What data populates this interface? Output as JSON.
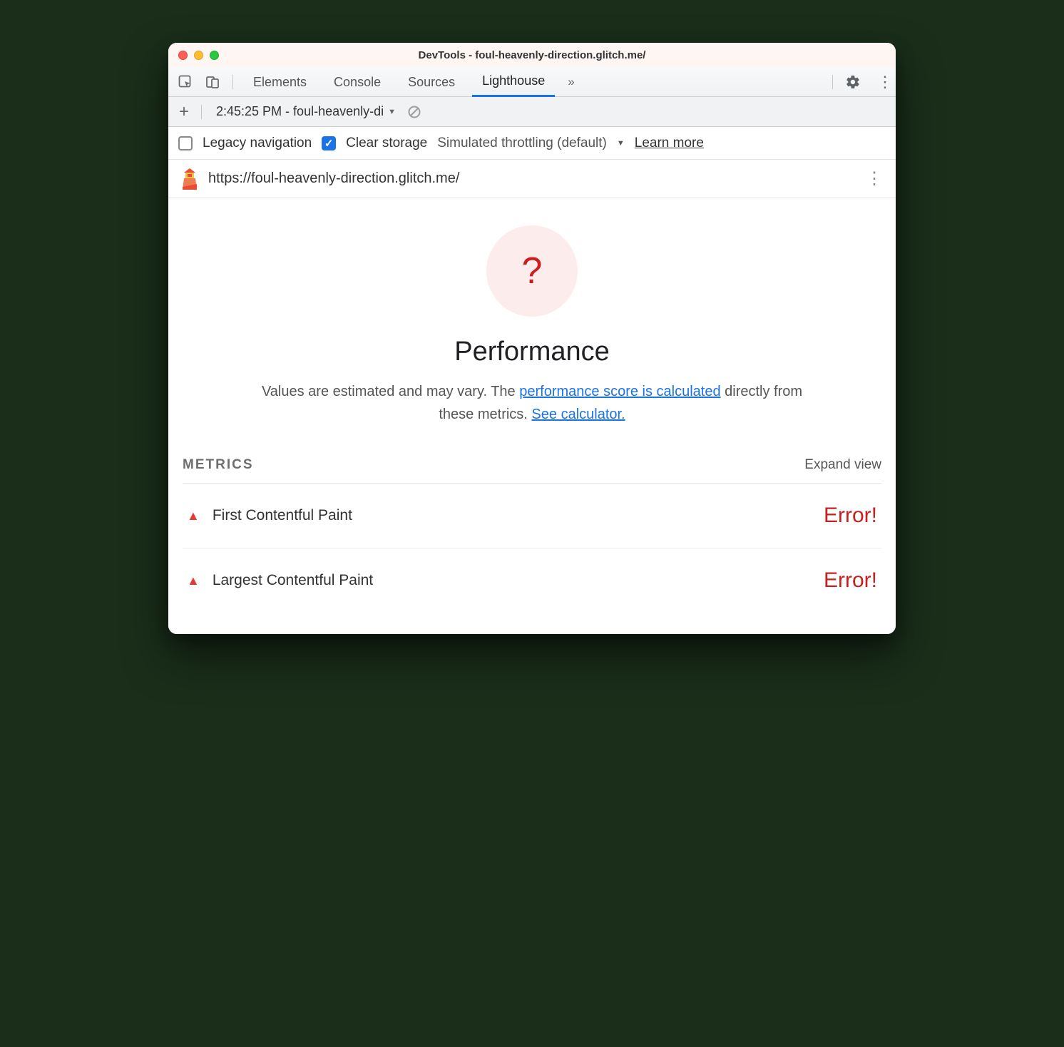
{
  "window": {
    "title": "DevTools - foul-heavenly-direction.glitch.me/"
  },
  "tabs": {
    "items": [
      "Elements",
      "Console",
      "Sources",
      "Lighthouse"
    ],
    "active": "Lighthouse",
    "overflow_glyph": "»"
  },
  "toolbar2": {
    "report_label": "2:45:25 PM - foul-heavenly-di"
  },
  "options": {
    "legacy_label": "Legacy navigation",
    "clear_label": "Clear storage",
    "throttling_label": "Simulated throttling (default)",
    "learn_more": "Learn more"
  },
  "urlbar": {
    "url": "https://foul-heavenly-direction.glitch.me/"
  },
  "score": {
    "glyph": "?",
    "title": "Performance",
    "desc_prefix": "Values are estimated and may vary. The ",
    "link1": "performance score is calculated",
    "desc_mid": " directly from these metrics. ",
    "link2": "See calculator."
  },
  "metrics": {
    "title": "METRICS",
    "expand": "Expand view",
    "rows": [
      {
        "name": "First Contentful Paint",
        "value": "Error!"
      },
      {
        "name": "Largest Contentful Paint",
        "value": "Error!"
      }
    ]
  }
}
